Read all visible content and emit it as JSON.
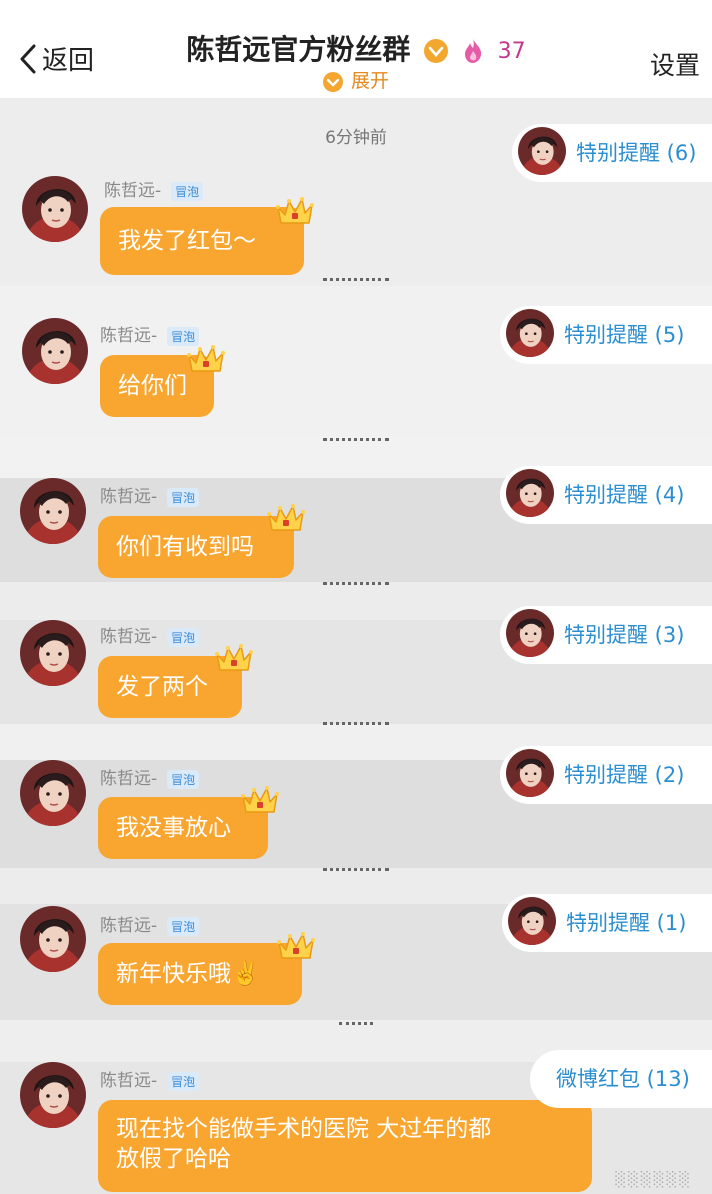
{
  "header": {
    "back_label": "返回",
    "title": "陈哲远官方粉丝群",
    "member_count": "37",
    "expand_label": "展开",
    "settings_label": "设置"
  },
  "sender": {
    "name": "陈哲远-",
    "tag": "冒泡"
  },
  "timestamps": {
    "first": "6分钟前"
  },
  "messages": [
    {
      "lines": [
        "我发了红包～"
      ]
    },
    {
      "lines": [
        "给你们"
      ]
    },
    {
      "lines": [
        "你们有收到吗"
      ]
    },
    {
      "lines": [
        "发了两个"
      ]
    },
    {
      "lines": [
        "我没事放心"
      ]
    },
    {
      "lines": [
        "新年快乐哦✌️"
      ]
    },
    {
      "lines": [
        "现在找个能做手术的医院 大过年的都",
        "放假了哈哈"
      ]
    }
  ],
  "reminders": [
    {
      "label": "特别提醒 (6)"
    },
    {
      "label": "特别提醒 (5)"
    },
    {
      "label": "特别提醒 (4)"
    },
    {
      "label": "特别提醒 (3)"
    },
    {
      "label": "特别提醒 (2)"
    },
    {
      "label": "特别提醒 (1)"
    },
    {
      "label": "微博红包 (13)"
    }
  ],
  "colors": {
    "bubble": "#f9a630",
    "link": "#2b8ed0",
    "background": "#e6e6e6"
  }
}
